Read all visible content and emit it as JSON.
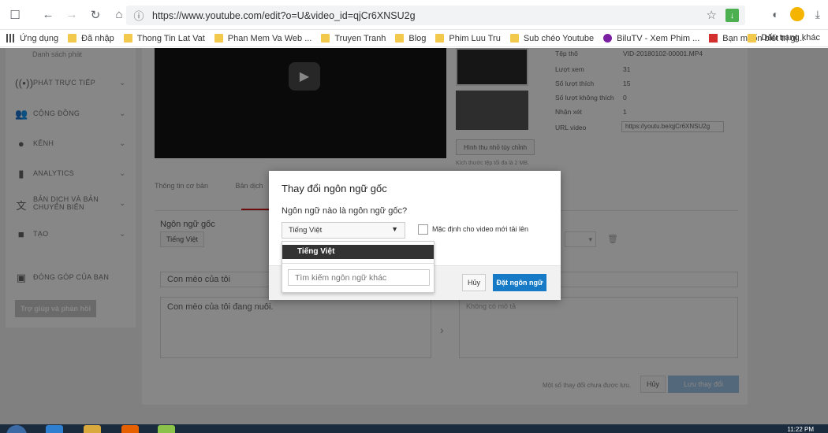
{
  "browser": {
    "url": "https://www.youtube.com/edit?o=U&video_id=qjCr6XNSU2g",
    "bookmarks": [
      {
        "label": "Ứng dụng",
        "icon": "apps"
      },
      {
        "label": "Đã nhập",
        "icon": "folder"
      },
      {
        "label": "Thong Tin Lat Vat",
        "icon": "folder"
      },
      {
        "label": "Phan Mem Va Web ...",
        "icon": "folder"
      },
      {
        "label": "Truyen Tranh",
        "icon": "folder"
      },
      {
        "label": "Blog",
        "icon": "folder"
      },
      {
        "label": "Phim Luu Tru",
        "icon": "folder"
      },
      {
        "label": "Sub chéo Youtube",
        "icon": "folder"
      },
      {
        "label": "BiluTV - Xem Phim ...",
        "icon": "bilu"
      },
      {
        "label": "Bạn muốn biết trị gi...",
        "icon": "red"
      }
    ],
    "other_bookmarks": "Dấu trang khác"
  },
  "sidebar": {
    "sub_item": "Danh sách phát",
    "items": [
      {
        "label": "PHÁT TRỰC TIẾP",
        "icon": "live-icon"
      },
      {
        "label": "CỘNG ĐỒNG",
        "icon": "community-icon"
      },
      {
        "label": "KÊNH",
        "icon": "channel-icon"
      },
      {
        "label": "ANALYTICS",
        "icon": "analytics-icon"
      },
      {
        "label": "BẢN DỊCH VÀ BẢN CHUYỂN BIÊN",
        "icon": "translate-icon"
      },
      {
        "label": "TẠO",
        "icon": "create-icon"
      },
      {
        "label": "ĐÓNG GÓP CỦA BẠN",
        "icon": "contribute-icon"
      }
    ],
    "help_button": "Trợ giúp và phản hồi"
  },
  "video_info": {
    "thumb_button": "Hình thu nhỏ tùy chỉnh",
    "thumb_note": "Kích thước tệp tối đa là 2 MB.",
    "rows": [
      {
        "k": "Tệp thô",
        "v": "VID-20180102-00001.MP4"
      },
      {
        "k": "Lượt xem",
        "v": "31"
      },
      {
        "k": "Số lượt thích",
        "v": "15"
      },
      {
        "k": "Số lượt không thích",
        "v": "0"
      },
      {
        "k": "Nhận xét",
        "v": "1"
      }
    ],
    "url_label": "URL video",
    "url_value": "https://youtu.be/qjCr6XNSU2g"
  },
  "editor": {
    "tab_basic": "Thông tin cơ bản",
    "tab_translation": "Bản dịch",
    "original_language_label": "Ngôn ngữ gốc",
    "original_language_value": "Tiếng Việt",
    "title_value": "Con mèo của tôi",
    "description_value": "Con mèo của tôi đang nuôi.",
    "right_desc_placeholder": "Không có mô tả",
    "unsaved_note": "Một số thay đổi chưa được lưu.",
    "cancel": "Hủy",
    "save": "Lưu thay đổi"
  },
  "modal": {
    "title": "Thay đổi ngôn ngữ gốc",
    "question": "Ngôn ngữ nào là ngôn ngữ gốc?",
    "selected_language": "Tiếng Việt",
    "default_checkbox_label": "Mặc định cho video mới tải lên",
    "cancel": "Hủy",
    "confirm": "Đặt ngôn ngữ"
  },
  "dropdown": {
    "selected": "Tiếng Việt",
    "search_placeholder": "Tìm kiếm ngôn ngữ khác"
  },
  "taskbar": {
    "clock": "11:22 PM"
  }
}
